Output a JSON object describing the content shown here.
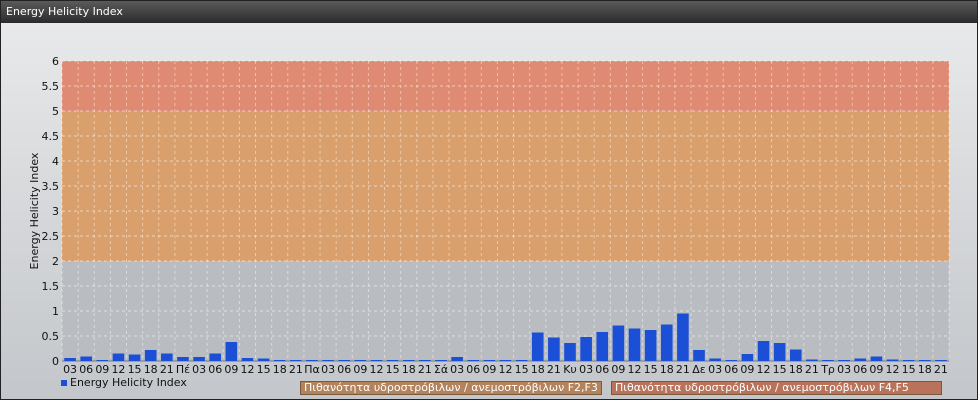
{
  "window": {
    "title": "Energy Helicity Index"
  },
  "colors": {
    "bar": "#1b4fd6",
    "band_high": "#df8a72",
    "band_mid": "#d99f6c",
    "band_low": "#b9bdc2",
    "legend_f2f3": "#b2835d",
    "legend_f4f5": "#b8735a"
  },
  "legend": {
    "series_label": "Energy Helicity Index",
    "bands": [
      {
        "label": "Πιθανότητα υδροστρόβιλων / ανεμοστρόβιλων F2,F3"
      },
      {
        "label": "Πιθανότητα υδροστρόβιλων / ανεμοστρόβιλων F4,F5"
      }
    ]
  },
  "chart_data": {
    "type": "bar",
    "title": "",
    "ylabel": "Energy Helicity Index",
    "xlabel": "",
    "ylim": [
      0,
      6
    ],
    "y_ticks": [
      "0",
      "0.5",
      "1",
      "1.5",
      "2",
      "2.5",
      "3",
      "3.5",
      "4",
      "4.5",
      "5",
      "5.5",
      "6"
    ],
    "grid": true,
    "bands": [
      {
        "from": 0,
        "to": 2,
        "color": "#b9bdc2"
      },
      {
        "from": 2,
        "to": 5,
        "color": "#d99f6c"
      },
      {
        "from": 5,
        "to": 6,
        "color": "#df8a72"
      }
    ],
    "categories": [
      "03",
      "06",
      "09",
      "12",
      "15",
      "18",
      "21",
      "Πέ",
      "03",
      "06",
      "09",
      "12",
      "15",
      "18",
      "21",
      "Πα",
      "03",
      "06",
      "09",
      "12",
      "15",
      "18",
      "21",
      "Σά",
      "03",
      "06",
      "09",
      "12",
      "15",
      "18",
      "21",
      "Κυ",
      "03",
      "06",
      "09",
      "12",
      "15",
      "18",
      "21",
      "Δε",
      "03",
      "06",
      "09",
      "12",
      "15",
      "18",
      "21",
      "Τρ",
      "03",
      "06",
      "09",
      "12",
      "15",
      "18",
      "21"
    ],
    "series": [
      {
        "values": [
          0.06,
          0.09,
          0.02,
          0.15,
          0.13,
          0.22,
          0.15,
          0.08,
          0.08,
          0.15,
          0.38,
          0.06,
          0.05,
          0.02,
          0.02,
          0.02,
          0.02,
          0.02,
          0.02,
          0.02,
          0.02,
          0.02,
          0.02,
          0.02,
          0.08,
          0.02,
          0.02,
          0.02,
          0.02,
          0.57,
          0.47,
          0.36,
          0.48,
          0.58,
          0.71,
          0.65,
          0.62,
          0.73,
          0.95,
          0.22,
          0.05,
          0.02,
          0.14,
          0.4,
          0.36,
          0.23,
          0.03,
          0.02,
          0.02,
          0.05,
          0.09,
          0.03,
          0.02,
          0.02,
          0.02
        ]
      }
    ]
  }
}
